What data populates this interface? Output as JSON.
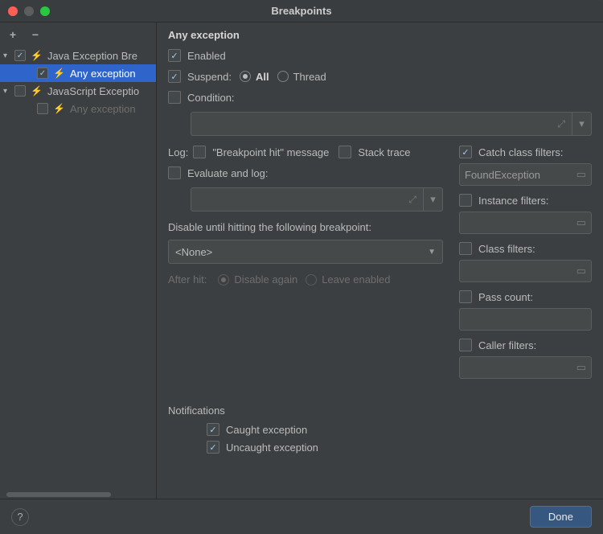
{
  "window": {
    "title": "Breakpoints"
  },
  "toolbar": {
    "add": "+",
    "remove": "−"
  },
  "tree": {
    "items": [
      {
        "label": "Java Exception Bre",
        "checked": true,
        "bolt": true,
        "boltDim": false,
        "dim": false,
        "indent": 1,
        "chev": "down",
        "selected": false
      },
      {
        "label": "Any exception",
        "checked": true,
        "bolt": true,
        "boltDim": false,
        "dim": false,
        "indent": 2,
        "chev": "none",
        "selected": true
      },
      {
        "label": "JavaScript Exceptio",
        "checked": false,
        "bolt": true,
        "boltDim": true,
        "dim": false,
        "indent": 1,
        "chev": "down",
        "selected": false
      },
      {
        "label": "Any exception",
        "checked": false,
        "bolt": true,
        "boltDim": true,
        "dim": true,
        "indent": 2,
        "chev": "none",
        "selected": false
      }
    ]
  },
  "detail": {
    "heading": "Any exception",
    "enabled": {
      "label": "Enabled",
      "checked": true
    },
    "suspend": {
      "label": "Suspend:",
      "checked": true,
      "all": "All",
      "thread": "Thread",
      "value": "all"
    },
    "condition": {
      "label": "Condition:",
      "checked": false,
      "value": ""
    },
    "log": {
      "label": "Log:",
      "bp_hit": {
        "label": "\"Breakpoint hit\" message",
        "checked": false
      },
      "stack": {
        "label": "Stack trace",
        "checked": false
      }
    },
    "eval": {
      "label": "Evaluate and log:",
      "checked": false,
      "value": ""
    },
    "disable_until": {
      "label": "Disable until hitting the following breakpoint:",
      "value": "<None>"
    },
    "after_hit": {
      "label": "After hit:",
      "disable_again": "Disable again",
      "leave": "Leave enabled",
      "value": "disable"
    },
    "filters": {
      "catch": {
        "label": "Catch class filters:",
        "checked": true,
        "value": "FoundException"
      },
      "instance": {
        "label": "Instance filters:",
        "checked": false,
        "value": ""
      },
      "class": {
        "label": "Class filters:",
        "checked": false,
        "value": ""
      },
      "pass": {
        "label": "Pass count:",
        "checked": false,
        "value": ""
      },
      "caller": {
        "label": "Caller filters:",
        "checked": false,
        "value": ""
      }
    },
    "notifications": {
      "heading": "Notifications",
      "caught": {
        "label": "Caught exception",
        "checked": true
      },
      "uncaught": {
        "label": "Uncaught exception",
        "checked": true
      }
    }
  },
  "footer": {
    "done": "Done",
    "help": "?"
  }
}
